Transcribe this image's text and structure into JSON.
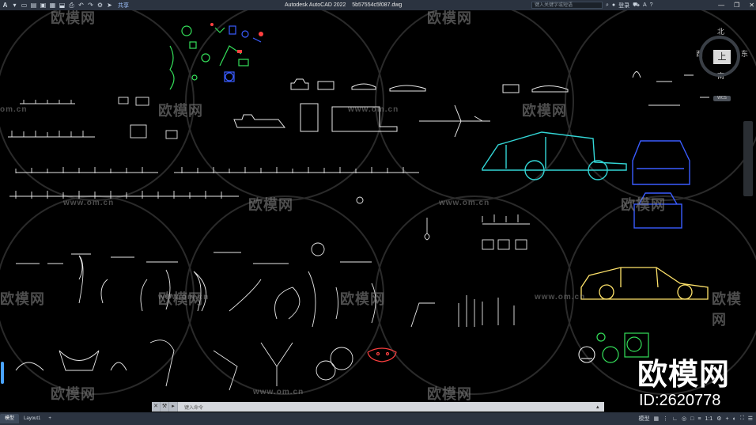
{
  "app": {
    "logo": "A",
    "title": "Autodesk AutoCAD 2022",
    "file": "5b57554c5f087.dwg",
    "share_label": "共享"
  },
  "quick_access_icons": [
    "menu-icon",
    "new-icon",
    "open-icon",
    "save-icon",
    "saveas-icon",
    "open-web-icon",
    "plot-icon",
    "undo-icon",
    "redo-icon",
    "workspace-icon"
  ],
  "search": {
    "placeholder": "键入关键字或短语"
  },
  "titlebar_right": {
    "signin_label": "登录"
  },
  "window_controls": {
    "minimize": "—",
    "restore": "❐",
    "close": "✕"
  },
  "watermarks": {
    "cn": "欧模网",
    "url": "www.om.cn",
    "url_short": "om.cn"
  },
  "viewcube": {
    "north": "北",
    "south": "南",
    "east": "东",
    "west": "西",
    "top": "上",
    "wcs": "WCS"
  },
  "brand": {
    "name": "欧模网",
    "id": "ID:2620778"
  },
  "command_line": {
    "placeholder": "键入命令"
  },
  "statusbar": {
    "tabs": [
      "模型",
      "Layout1",
      "+"
    ],
    "active_tab": "模型",
    "right_label": "模型",
    "scale": "1:1"
  },
  "colors": {
    "cyan": "#33d6d6",
    "blue": "#3a5cff",
    "yellow": "#ffe36a",
    "green": "#34e05a",
    "red": "#ff4040",
    "white": "#e8e8e8"
  }
}
